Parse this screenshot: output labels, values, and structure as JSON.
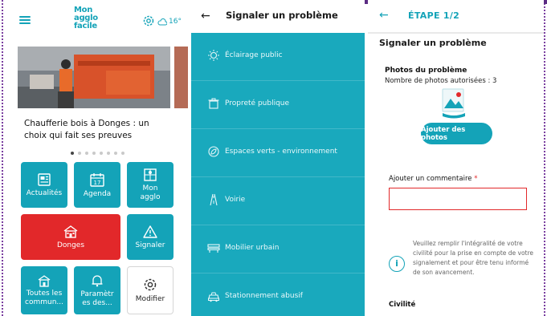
{
  "home": {
    "logo_line1": "Mon",
    "logo_line2": "agglo",
    "logo_line3": "facile",
    "weather_temp": "16°",
    "news_title": "Chaufferie bois à Donges : un choix qui fait ses preuves",
    "carousel_dots": 8,
    "carousel_active": 1,
    "tiles": [
      {
        "label": "Actualités"
      },
      {
        "label": "Agenda",
        "day": "17"
      },
      {
        "label": "Mon agglo"
      },
      {
        "label": "Donges"
      },
      {
        "label": "Signaler"
      },
      {
        "label": "Toutes les commun..."
      },
      {
        "label": "Paramètr es des..."
      },
      {
        "label": "Modifier"
      }
    ]
  },
  "report_list": {
    "title": "Signaler un problème",
    "categories": [
      {
        "label": "Éclairage public",
        "icon": "lightbulb-icon"
      },
      {
        "label": "Propreté publique",
        "icon": "trash-icon"
      },
      {
        "label": "Espaces verts - environnement",
        "icon": "leaf-icon"
      },
      {
        "label": "Voirie",
        "icon": "road-icon"
      },
      {
        "label": "Mobilier urbain",
        "icon": "bench-icon"
      },
      {
        "label": "Stationnement abusif",
        "icon": "car-icon"
      }
    ]
  },
  "report_form": {
    "step": "ÉTAPE 1/2",
    "heading": "Signaler un problème",
    "photos_label": "Photos du problème",
    "photos_sub": "Nombre de photos autorisées : 3",
    "add_photos_button": "Ajouter des photos",
    "comment_label": "Ajouter un commentaire",
    "required_mark": "*",
    "info_text": "Veuillez remplir l'intégralité de votre civilité pour la prise en compte de votre signalement et pour être tenu informé de son avancement.",
    "civility_label": "Civilité"
  },
  "colors": {
    "teal": "#14a3b8",
    "red": "#e2282a",
    "purple": "#5b2c83"
  }
}
